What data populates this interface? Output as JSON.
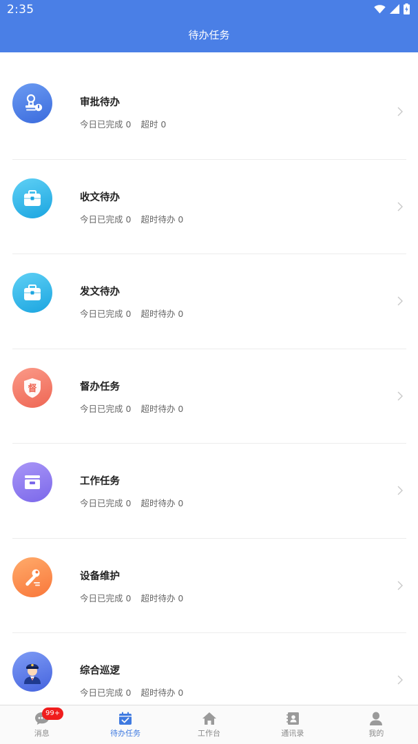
{
  "status_bar": {
    "time": "2:35",
    "icons": [
      "wifi-icon",
      "signal-icon",
      "battery-charging-icon"
    ]
  },
  "header": {
    "title": "待办任务"
  },
  "tasks": [
    {
      "title": "审批待办",
      "done": "今日已完成 0",
      "overdue": "超时 0",
      "icon": "stamp-icon",
      "color": "#4b7ee3"
    },
    {
      "title": "收文待办",
      "done": "今日已完成 0",
      "overdue": "超时待办 0",
      "icon": "briefcase-icon",
      "color": "#29b3e8"
    },
    {
      "title": "发文待办",
      "done": "今日已完成 0",
      "overdue": "超时待办 0",
      "icon": "briefcase-icon",
      "color": "#29b3e8"
    },
    {
      "title": "督办任务",
      "done": "今日已完成 0",
      "overdue": "超时待办 0",
      "icon": "shield-du-icon",
      "color": "#f27464"
    },
    {
      "title": "工作任务",
      "done": "今日已完成 0",
      "overdue": "超时待办 0",
      "icon": "inbox-tray-icon",
      "color": "#8e7cf0"
    },
    {
      "title": "设备维护",
      "done": "今日已完成 0",
      "overdue": "超时待办 0",
      "icon": "wrench-icon",
      "color": "#fb8a4c"
    },
    {
      "title": "综合巡逻",
      "done": "今日已完成 0",
      "overdue": "超时待办 0",
      "icon": "police-officer-icon",
      "color": "#5876e6"
    }
  ],
  "shield_glyph": "督",
  "bottom_nav": [
    {
      "label": "消息",
      "icon": "chat-icon",
      "badge": "99+"
    },
    {
      "label": "待办任务",
      "icon": "calendar-check-icon",
      "active": true
    },
    {
      "label": "工作台",
      "icon": "home-icon"
    },
    {
      "label": "通讯录",
      "icon": "contacts-book-icon"
    },
    {
      "label": "我的",
      "icon": "person-icon"
    }
  ],
  "colors": {
    "primary": "#4a7fe6",
    "active_tab": "#3f7ae0",
    "badge": "#f01d1d"
  }
}
